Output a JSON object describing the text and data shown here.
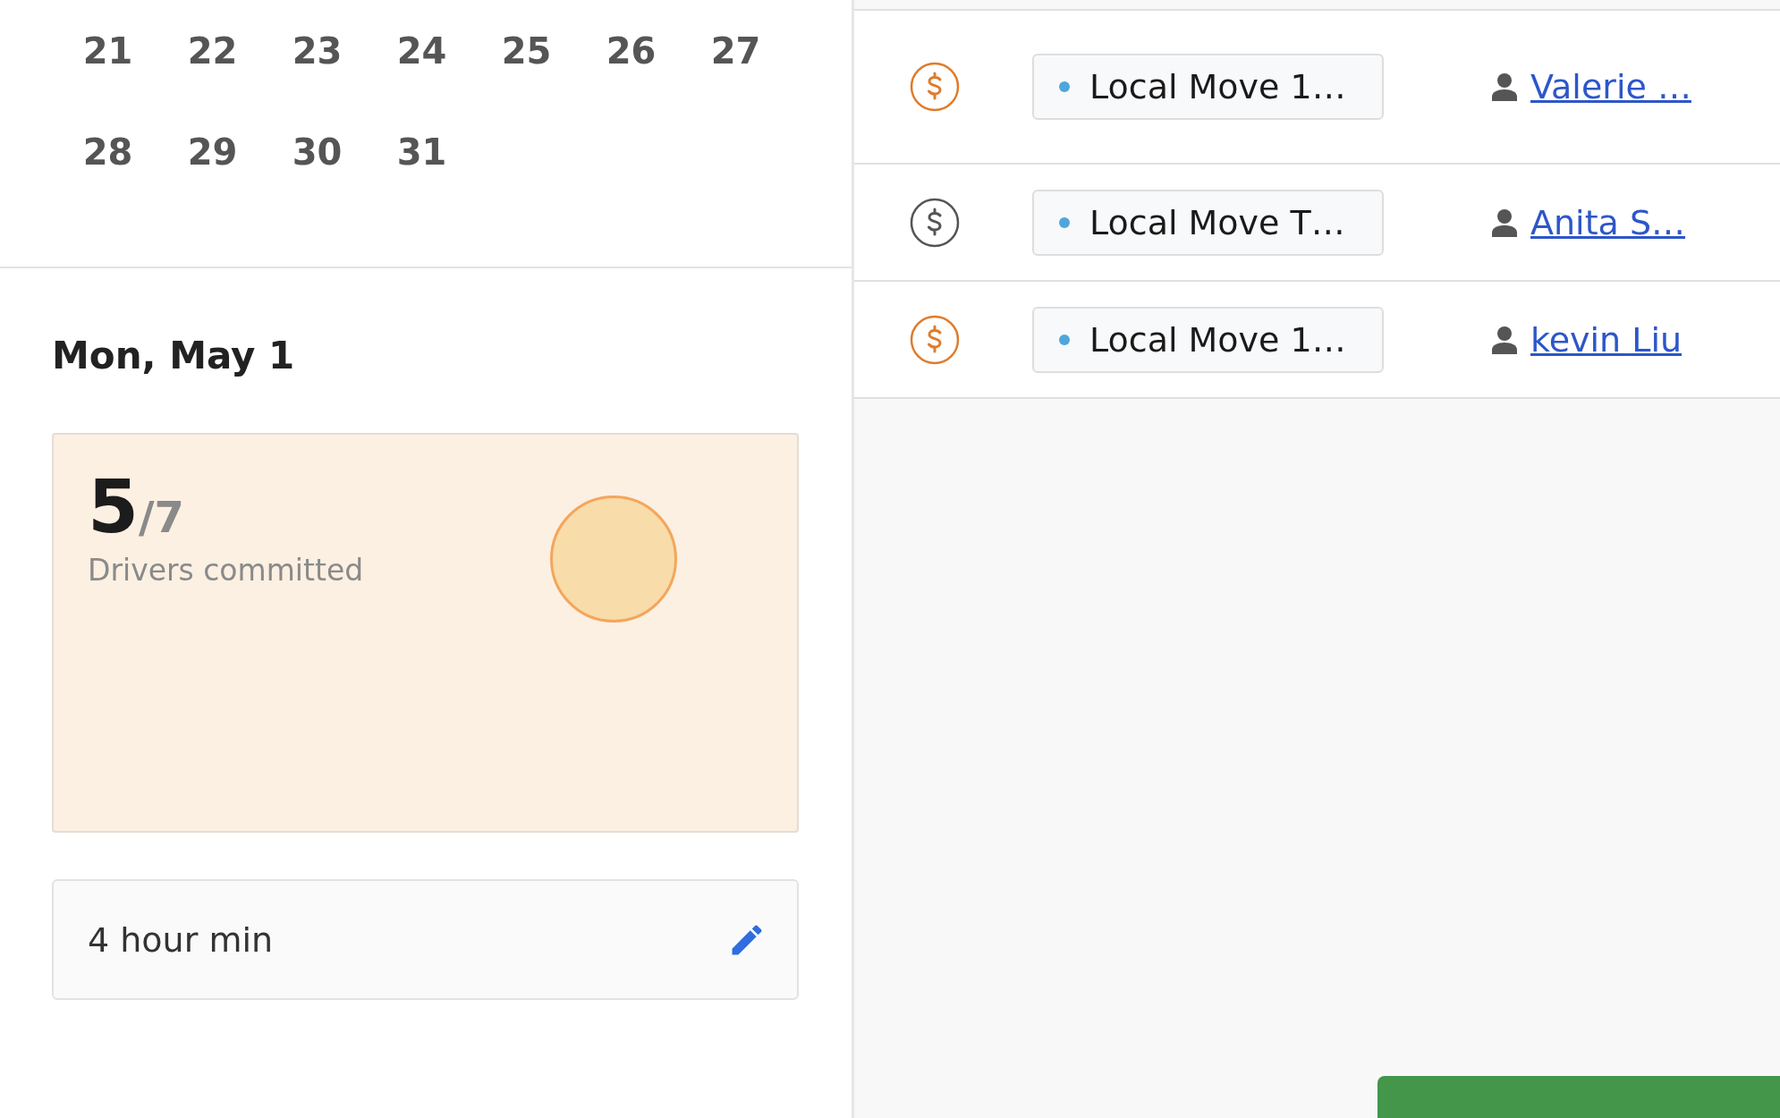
{
  "calendar": {
    "days": [
      "21",
      "22",
      "23",
      "24",
      "25",
      "26",
      "27",
      "28",
      "29",
      "30",
      "31"
    ]
  },
  "day_panel": {
    "title": "Mon, May 1",
    "drivers": {
      "count": "5",
      "total": "/7",
      "label": "Drivers committed"
    },
    "minimum": {
      "value": "4 hour min"
    }
  },
  "jobs": [
    {
      "color": "#e07b2a",
      "job": "Local Move 1…",
      "customer": "Valerie …"
    },
    {
      "color": "#555555",
      "job": "Local Move T…",
      "customer": "Anita S…"
    },
    {
      "color": "#e07b2a",
      "job": "Local Move 1…",
      "customer": "kevin Liu"
    }
  ]
}
